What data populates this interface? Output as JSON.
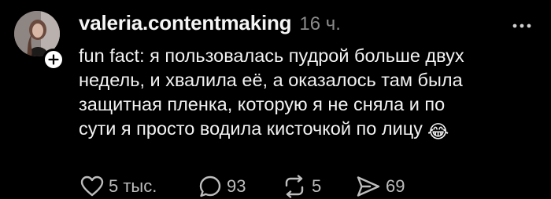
{
  "post": {
    "username": "valeria.contentmaking",
    "timestamp": "16 ч.",
    "text_lines": [
      "fun fact: я пользовалась пудрой больше двух",
      "недель, и хвалила её, а оказалось там была",
      "защитная пленка, которую я не сняла и по",
      "сути я просто водила кисточкой по лицу"
    ],
    "emoji": "😂"
  },
  "actions": {
    "likes": "5 тыс.",
    "comments": "93",
    "reposts": "5",
    "shares": "69"
  },
  "icons": {
    "avatar": "avatar",
    "follow": "plus-icon",
    "more": "more-dots-icon",
    "like": "heart-icon",
    "comment": "comment-icon",
    "repost": "repost-icon",
    "share": "send-icon"
  },
  "colors": {
    "background": "#000000",
    "text": "#f2f2f2",
    "muted": "#8a8a8a",
    "icon": "#bdbdbd"
  }
}
